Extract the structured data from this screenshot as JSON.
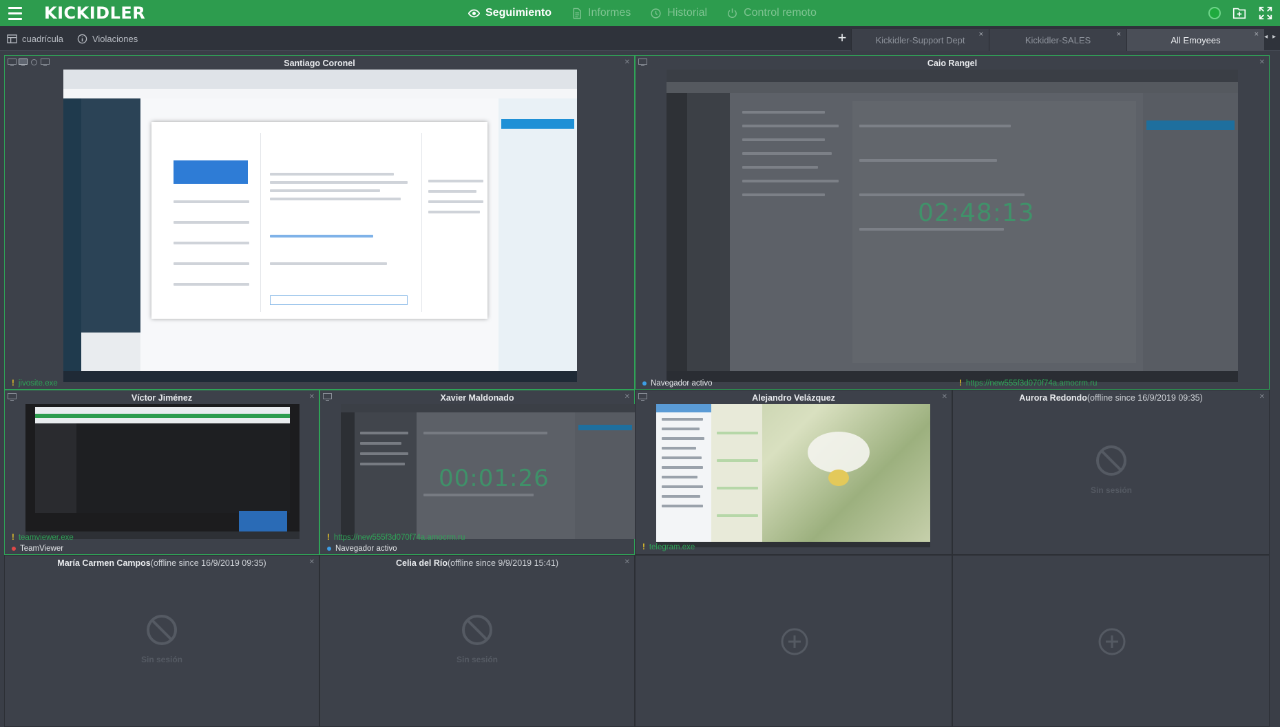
{
  "app": {
    "logo": "KICKIDLER",
    "nav": [
      {
        "label": "Seguimiento",
        "icon": "eye-icon",
        "active": true
      },
      {
        "label": "Informes",
        "icon": "document-icon",
        "active": false
      },
      {
        "label": "Historial",
        "icon": "history-icon",
        "active": false
      },
      {
        "label": "Control remoto",
        "icon": "power-icon",
        "active": false
      }
    ]
  },
  "toolbar": {
    "grid_label": "cuadrícula",
    "violations_label": "Violaciones",
    "add_symbol": "+",
    "tabs": [
      {
        "label": "Kickidler-Support Dept",
        "active": false
      },
      {
        "label": "Kickidler-SALES",
        "active": false
      },
      {
        "label": "All Emoyees",
        "active": true
      }
    ],
    "close_symbol": "×",
    "arrows": "◂ ▸"
  },
  "cells": {
    "santiago": {
      "name": "Santiago Coronel",
      "app": "jivosite.exe"
    },
    "caio": {
      "name": "Caio Rangel",
      "status": "Navegador activo",
      "url": "https://new555f3d070f74a.amocrm.ru",
      "timer": "02:48:13"
    },
    "victor": {
      "name": "Víctor Jiménez",
      "app": "teamviewer.exe",
      "status": "TeamViewer"
    },
    "xavier": {
      "name": "Xavier Maldonado",
      "url": "https://new555f3d070f74a.amocrm.ru",
      "status": "Navegador activo",
      "timer": "00:01:26"
    },
    "alejandro": {
      "name": "Alejandro Velázquez",
      "app": "telegram.exe"
    },
    "aurora": {
      "name": "Aurora Redondo",
      "offline": "(offline since 16/9/2019 09:35)",
      "session": "Sin sesión"
    },
    "maria": {
      "name": "María Carmen Campos",
      "offline": "(offline since 16/9/2019 09:35)",
      "session": "Sin sesión"
    },
    "celia": {
      "name": "Celia del Río",
      "offline": "(offline since 9/9/2019 15:41)",
      "session": "Sin sesión"
    }
  },
  "colors": {
    "brand_green": "#2d9c4e",
    "active_border": "#2fa357",
    "background": "#3a3e47"
  }
}
